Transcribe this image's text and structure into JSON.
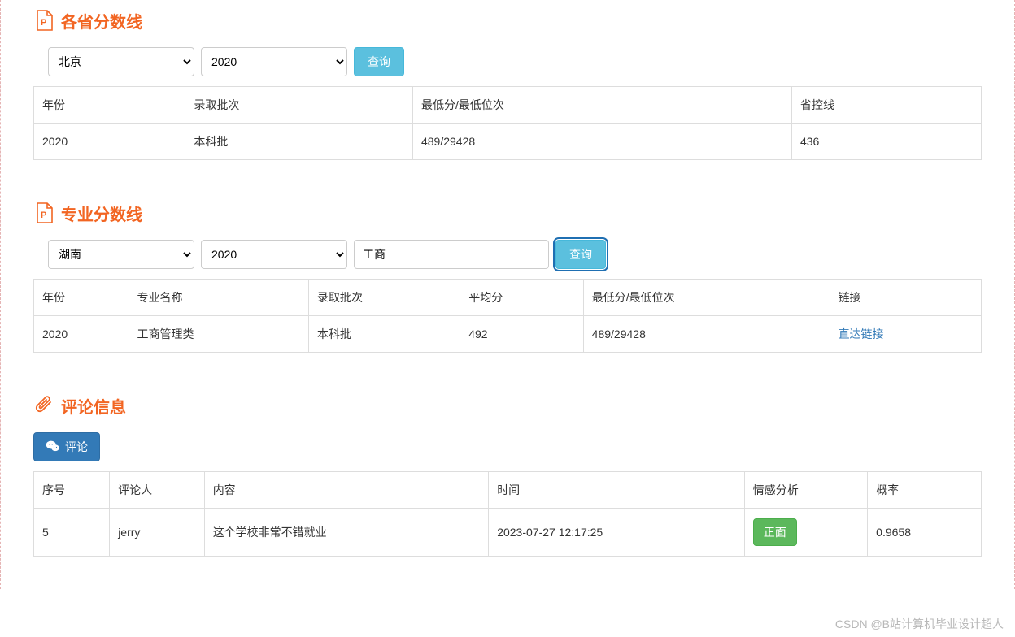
{
  "section1": {
    "title": "各省分数线",
    "iconColor": "#f26522",
    "provinceSelected": "北京",
    "yearSelected": "2020",
    "queryLabel": "查询",
    "headers": [
      "年份",
      "录取批次",
      "最低分/最低位次",
      "省控线"
    ],
    "rows": [
      {
        "year": "2020",
        "batch": "本科批",
        "min": "489/29428",
        "control": "436"
      }
    ]
  },
  "section2": {
    "title": "专业分数线",
    "iconColor": "#f26522",
    "provinceSelected": "湖南",
    "yearSelected": "2020",
    "majorInput": "工商",
    "queryLabel": "查询",
    "headers": [
      "年份",
      "专业名称",
      "录取批次",
      "平均分",
      "最低分/最低位次",
      "链接"
    ],
    "rows": [
      {
        "year": "2020",
        "major": "工商管理类",
        "batch": "本科批",
        "avg": "492",
        "min": "489/29428",
        "linkLabel": "直达链接"
      }
    ]
  },
  "section3": {
    "title": "评论信息",
    "iconColor": "#f26522",
    "commentBtnLabel": "评论",
    "headers": [
      "序号",
      "评论人",
      "内容",
      "时间",
      "情感分析",
      "概率"
    ],
    "rows": [
      {
        "no": "5",
        "user": "jerry",
        "content": "这个学校非常不错就业",
        "time": "2023-07-27 12:17:25",
        "sentimentLabel": "正面",
        "prob": "0.9658"
      }
    ]
  },
  "watermark": "CSDN @B站计算机毕业设计超人"
}
